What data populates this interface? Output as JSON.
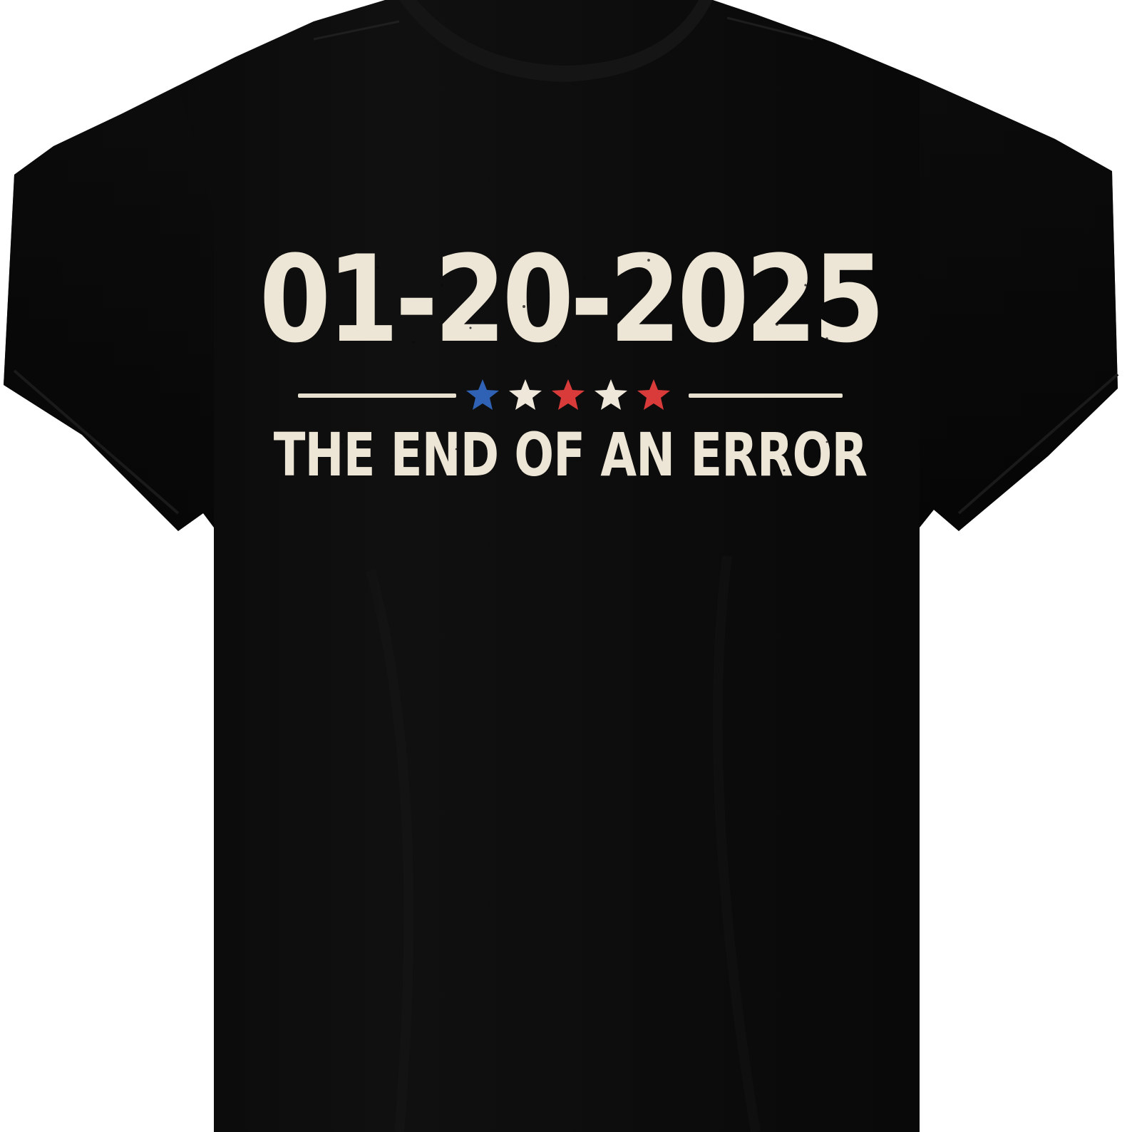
{
  "shirt": {
    "date_text": "01-20-2025",
    "slogan_text": "THE END OF AN ERROR",
    "star_colors": [
      "#2f62b5",
      "#efe8da",
      "#d93a3a",
      "#efe8da",
      "#d93a3a"
    ],
    "shirt_color": "#0b0b0b",
    "print_color": "#ede6d6"
  }
}
